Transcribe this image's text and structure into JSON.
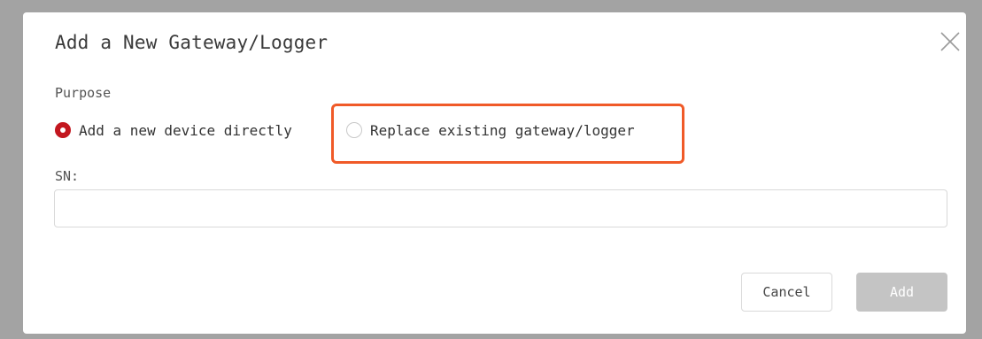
{
  "dialog": {
    "title": "Add a New Gateway/Logger",
    "close_icon": "close-icon"
  },
  "purpose": {
    "label": "Purpose",
    "options": [
      {
        "label": "Add a new device directly",
        "selected": true
      },
      {
        "label": "Replace existing gateway/logger",
        "selected": false
      }
    ],
    "highlight_color": "#f05a28",
    "accent_color": "#c3171f"
  },
  "sn": {
    "label": "SN:",
    "value": "",
    "placeholder": ""
  },
  "buttons": {
    "cancel_label": "Cancel",
    "add_label": "Add"
  }
}
